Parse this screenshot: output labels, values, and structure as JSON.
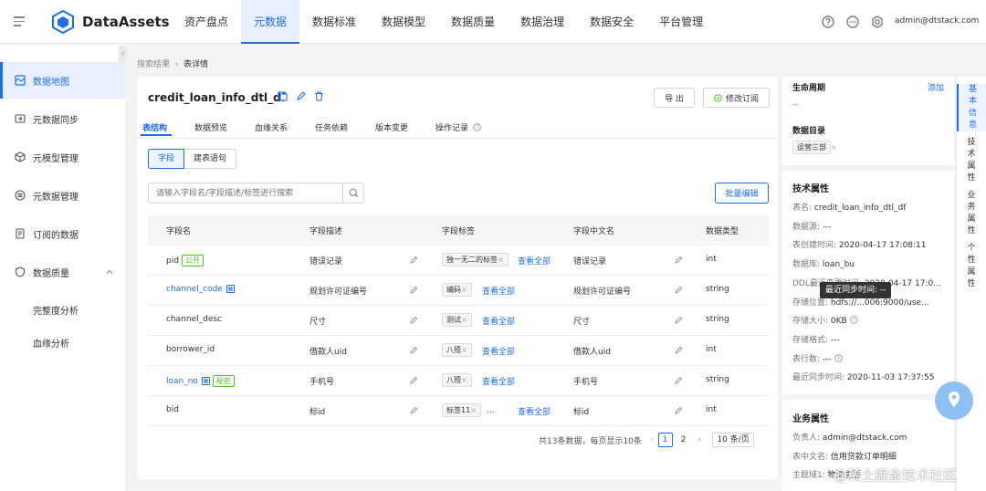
{
  "app": {
    "name": "DataAssets",
    "user": "admin@dtstack.com"
  },
  "nav": [
    "资产盘点",
    "元数据",
    "数据标准",
    "数据模型",
    "数据质量",
    "数据治理",
    "数据安全",
    "平台管理"
  ],
  "header_icons": [
    "help-circle-icon",
    "chat-icon",
    "gear-icon"
  ],
  "sidebar": {
    "items": [
      {
        "label": "数据地图",
        "icon": "map-icon"
      },
      {
        "label": "元数据同步",
        "icon": "sync-icon"
      },
      {
        "label": "元模型管理",
        "icon": "cube-icon"
      },
      {
        "label": "元数据管理",
        "icon": "database-icon"
      },
      {
        "label": "订阅的数据",
        "icon": "subscribe-icon"
      },
      {
        "label": "数据质量",
        "icon": "shield-icon"
      }
    ],
    "sub_items": [
      "完整度分析",
      "血缘分析"
    ]
  },
  "breadcrumb": {
    "parent": "搜索结果",
    "current": "表详情"
  },
  "table_detail": {
    "name": "credit_loan_info_dtl_df",
    "export_label": "导 出",
    "edit_sub_label": "修改订阅",
    "tabs": [
      "表结构",
      "数据预览",
      "血缘关系",
      "任务依赖",
      "版本变更",
      "操作记录"
    ],
    "segments": [
      "字段",
      "建表语句"
    ],
    "search_placeholder": "请输入字段名/字段描述/标签进行搜索",
    "batch_edit_label": "批量编辑",
    "columns": [
      "字段名",
      "字段描述",
      "字段标签",
      "字段中文名",
      "数据类型"
    ],
    "rows": [
      {
        "name": "pid",
        "badge": "公开",
        "table_icon": false,
        "link": false,
        "desc": "错误记录",
        "tag": "独一无二的标签",
        "extra": "",
        "cn": "错误记录",
        "type": "int"
      },
      {
        "name": "channel_code",
        "badge": "",
        "table_icon": true,
        "link": true,
        "desc": "规划许可证编号",
        "tag": "编码",
        "extra": "",
        "cn": "规划许可证编号",
        "type": "string"
      },
      {
        "name": "channel_desc",
        "badge": "",
        "table_icon": false,
        "link": false,
        "desc": "尺寸",
        "tag": "测试",
        "extra": "",
        "cn": "尺寸",
        "type": "string"
      },
      {
        "name": "borrower_id",
        "badge": "",
        "table_icon": false,
        "link": false,
        "desc": "借款人uid",
        "tag": "八殪",
        "extra": "",
        "cn": "借款人uid",
        "type": "int"
      },
      {
        "name": "loan_no",
        "badge": "秘密",
        "table_icon": true,
        "link": true,
        "desc": "手机号",
        "tag": "八殪",
        "extra": "",
        "cn": "手机号",
        "type": "string"
      },
      {
        "name": "bid",
        "badge": "",
        "table_icon": false,
        "link": false,
        "desc": "标id",
        "tag": "标签11",
        "extra": "...",
        "cn": "标id",
        "type": "int"
      }
    ],
    "view_all": "查看全部",
    "pager": {
      "total_text": "共13条数据，每页显示10条",
      "pages": [
        "1",
        "2"
      ],
      "page_size": "10 条/页"
    }
  },
  "info": {
    "lifecycle_label": "生命周期",
    "add_label": "添加",
    "lifecycle_value": "--",
    "catalog_label": "数据目录",
    "catalog_tag": "运营三部",
    "tech_title": "技术属性",
    "tech": [
      {
        "k": "表名:",
        "v": "credit_loan_info_dtl_df"
      },
      {
        "k": "数据源:",
        "v": "---"
      },
      {
        "k": "表创建时间:",
        "v": "2020-04-17 17:08:11"
      },
      {
        "k": "数据库:",
        "v": "loan_bu"
      },
      {
        "k": "DDL最近变更时间:",
        "v": "2020-04-17 17:0..."
      },
      {
        "k": "存储位置:",
        "v": "hdfs://...006:9000/use..."
      },
      {
        "k": "存储大小:",
        "v": "0KB"
      },
      {
        "k": "存储格式:",
        "v": "---"
      },
      {
        "k": "表行数:",
        "v": "---"
      },
      {
        "k": "最近同步时间:",
        "v": "2020-11-03 17:37:55"
      }
    ],
    "tooltip": "最近同步时间: --",
    "biz_title": "业务属性",
    "biz": [
      {
        "k": "负责人:",
        "v": "admin@dtstack.com"
      },
      {
        "k": "表中文名:",
        "v": "信用贷款订单明细"
      },
      {
        "k": "主题域1:",
        "v": "物流主题"
      }
    ]
  },
  "vertical_tabs": [
    "基本信息",
    "技术属性",
    "业务属性",
    "个性属性"
  ],
  "watermark": "@稀土掘金技术社区",
  "colors": {
    "accent": "#1f6ee8",
    "green": "#52c41a"
  }
}
